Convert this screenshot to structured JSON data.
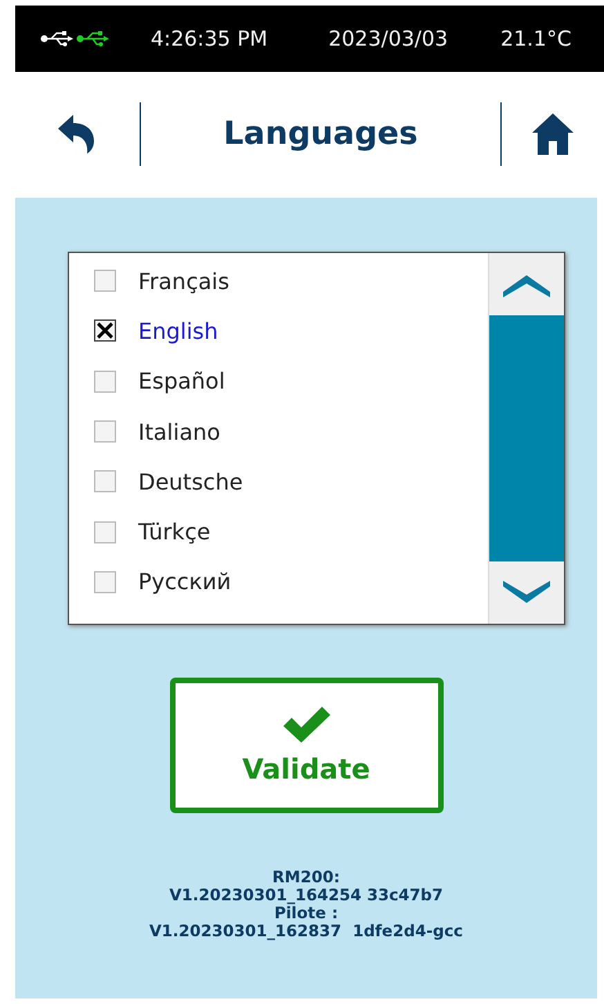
{
  "status_bar": {
    "usb_indicators": [
      {
        "color": "#ffffff"
      },
      {
        "color": "#22cc22"
      }
    ],
    "time": "4:26:35 PM",
    "date": "2023/03/03",
    "temperature": "21.1°C"
  },
  "header": {
    "title": "Languages"
  },
  "languages": [
    {
      "label": "Français",
      "checked": false
    },
    {
      "label": "English",
      "checked": true
    },
    {
      "label": "Español",
      "checked": false
    },
    {
      "label": "Italiano",
      "checked": false
    },
    {
      "label": "Deutsche",
      "checked": false
    },
    {
      "label": "Türkçe",
      "checked": false
    },
    {
      "label": "Русский",
      "checked": false
    }
  ],
  "validate_button": {
    "label": "Validate"
  },
  "version_info": [
    "RM200:",
    "V1.20230301_164254 33c47b7",
    "Pilote :",
    "V1.20230301_162837  1dfe2d4-gcc"
  ]
}
